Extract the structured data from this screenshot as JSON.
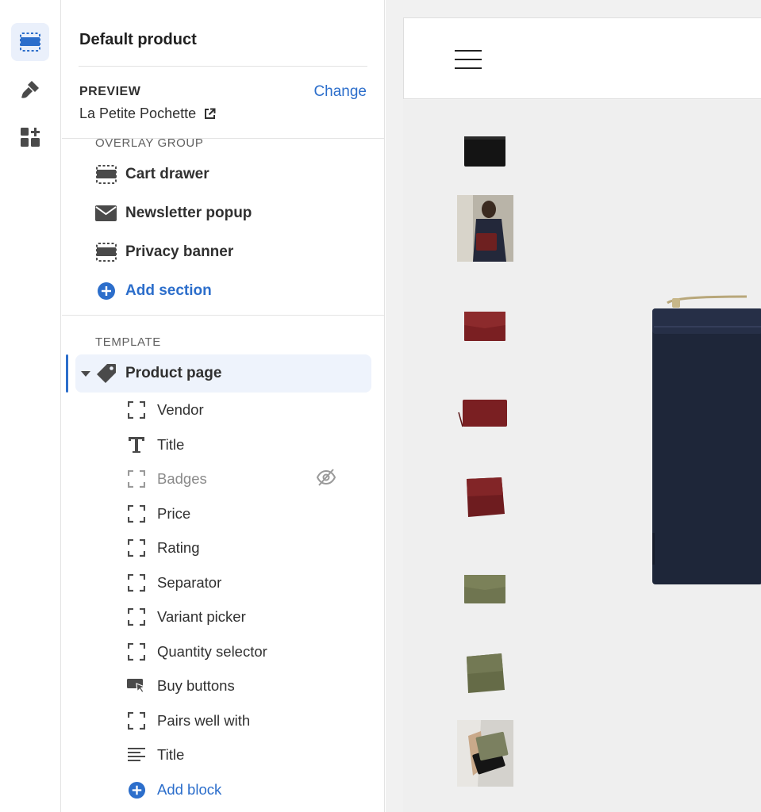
{
  "panel": {
    "title": "Default product",
    "preview": {
      "label": "PREVIEW",
      "change_label": "Change",
      "product_name": "La Petite Pochette"
    }
  },
  "overlay_group": {
    "label": "OVERLAY GROUP",
    "items": [
      {
        "label": "Cart drawer",
        "icon": "section-dashed-icon"
      },
      {
        "label": "Newsletter popup",
        "icon": "envelope-icon"
      },
      {
        "label": "Privacy banner",
        "icon": "section-dashed-icon"
      }
    ],
    "add_label": "Add section"
  },
  "template": {
    "label": "TEMPLATE",
    "page_label": "Product page",
    "blocks": [
      {
        "label": "Vendor",
        "icon": "block-dashed-icon"
      },
      {
        "label": "Title",
        "icon": "text-icon"
      },
      {
        "label": "Badges",
        "icon": "block-dashed-icon",
        "hidden": true
      },
      {
        "label": "Price",
        "icon": "block-dashed-icon"
      },
      {
        "label": "Rating",
        "icon": "block-dashed-icon"
      },
      {
        "label": "Separator",
        "icon": "block-dashed-icon"
      },
      {
        "label": "Variant picker",
        "icon": "block-dashed-icon"
      },
      {
        "label": "Quantity selector",
        "icon": "block-dashed-icon"
      },
      {
        "label": "Buy buttons",
        "icon": "buy-button-icon"
      },
      {
        "label": "Pairs well with",
        "icon": "block-dashed-icon"
      },
      {
        "label": "Title",
        "icon": "paragraph-icon"
      }
    ],
    "add_label": "Add block"
  },
  "colors": {
    "accent": "#2c6ecb",
    "selected_bg": "#eef3fc",
    "navy": "#1e2639",
    "burgundy": "#7a1f22",
    "olive": "#6f7550"
  }
}
